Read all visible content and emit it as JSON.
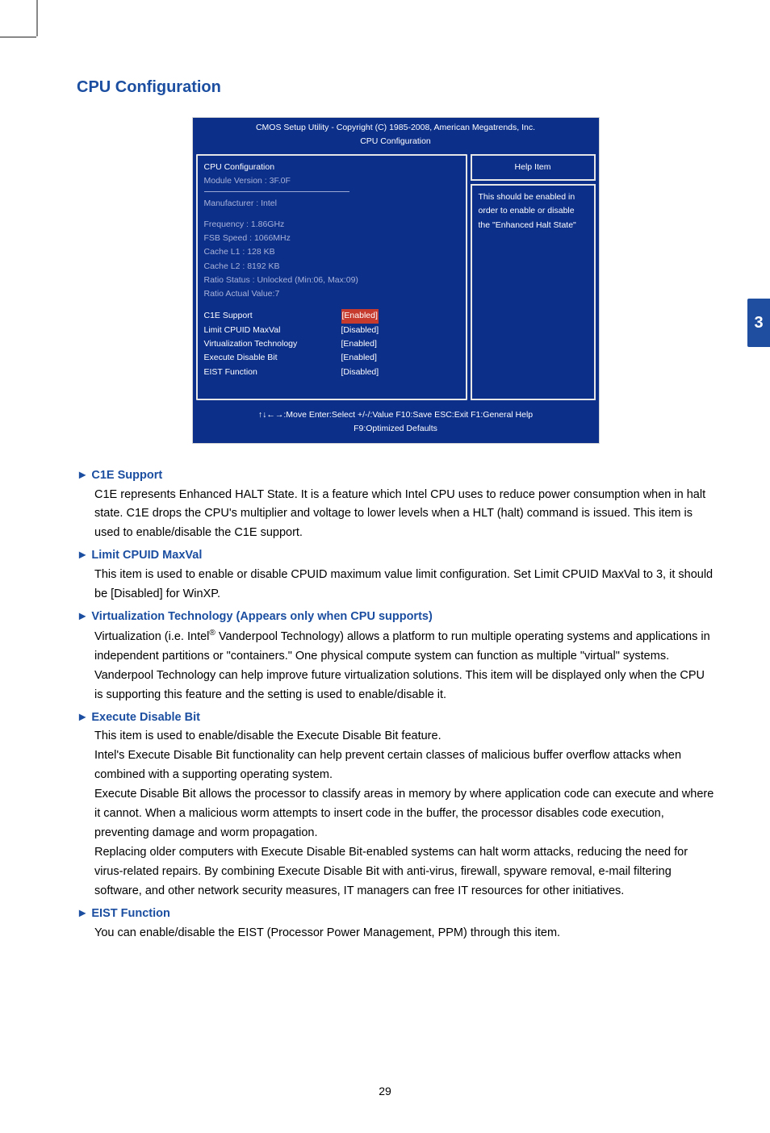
{
  "page_title": "CPU Configuration",
  "side_tab": "3",
  "page_number": "29",
  "bios": {
    "header_line1": "CMOS Setup Utility - Copyright (C) 1985-2008, American Megatrends, Inc.",
    "header_line2": "CPU Configuration",
    "main": {
      "section_title": "CPU Configuration",
      "module_version": "Module Version :  3F.0F",
      "manufacturer": "Manufacturer : Intel",
      "specs": [
        "Frequency    : 1.86GHz",
        "FSB Speed   : 1066MHz",
        "Cache L1      : 128 KB",
        "Cache L2      : 8192 KB",
        "Ratio  Status : Unlocked (Min:06, Max:09)",
        "Ratio Actual Value:7"
      ],
      "settings": [
        {
          "label": "C1E Support",
          "value": "[Enabled]",
          "selected": true
        },
        {
          "label": "Limit CPUID MaxVal",
          "value": "[Disabled]",
          "selected": false
        },
        {
          "label": "Virtualization Technology",
          "value": "[Enabled]",
          "selected": false
        },
        {
          "label": "Execute Disable Bit",
          "value": "[Enabled]",
          "selected": false
        },
        {
          "label": "EIST Function",
          "value": "[Disabled]",
          "selected": false
        }
      ]
    },
    "help": {
      "title": "Help Item",
      "body": "This should be enabled in order to enable or disable the \"Enhanced Halt State\""
    },
    "footer_line1": "↑↓←→:Move   Enter:Select      +/-/:Value    F10:Save       ESC:Exit     F1:General Help",
    "footer_line2": "F9:Optimized Defaults"
  },
  "sections": {
    "c1e": {
      "title": "►  C1E Support",
      "body": "C1E represents Enhanced HALT State. It is a feature which Intel CPU uses to reduce power consumption when in halt state. C1E drops the CPU's multiplier and voltage to lower levels when a HLT (halt) command is issued. This item is used to enable/disable the C1E support."
    },
    "limit": {
      "title": "►  Limit CPUID MaxVal",
      "body": "This item is used to enable or disable CPUID maximum value limit configuration. Set Limit CPUID MaxVal to 3, it should be [Disabled] for WinXP."
    },
    "vt": {
      "title": "►  Virtualization Technology  (Appears only when CPU supports)",
      "body_pre": "Virtualization (i.e. Intel",
      "reg": "®",
      "body_post": " Vanderpool Technology) allows a platform to run multiple operating systems and applications in independent partitions or \"containers.\" One physical compute system can function as multiple \"virtual\" systems. Vanderpool Technology can help improve future virtualization solutions. This item will be displayed only when the CPU is supporting this feature and the setting is used to enable/disable it."
    },
    "edb": {
      "title": "►  Execute Disable Bit",
      "p1": "This item is used to enable/disable the Execute Disable Bit feature.",
      "p2": "Intel's Execute Disable Bit functionality can help prevent certain classes of malicious buffer overflow attacks when combined with a supporting operating system.",
      "p3": "Execute Disable Bit allows the processor to classify areas in memory by where application code can execute and where it cannot. When a malicious worm attempts to insert code in the buffer, the processor disables code execution, preventing damage and worm propagation.",
      "p4": "Replacing older computers with Execute Disable Bit-enabled systems can halt worm attacks, reducing the need for virus-related repairs. By combining Execute Disable Bit with anti-virus, firewall, spyware removal, e-mail filtering software, and other network security measures, IT managers can free IT resources for other initiatives."
    },
    "eist": {
      "title": "►  EIST Function",
      "body": "You can enable/disable the EIST (Processor Power Management, PPM) through this item."
    }
  }
}
